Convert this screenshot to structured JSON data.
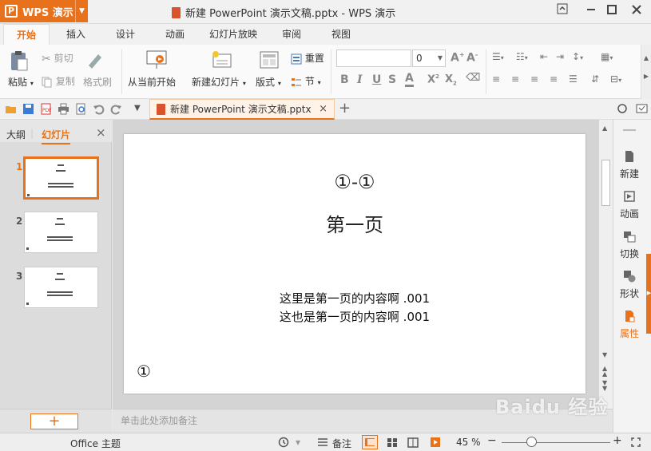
{
  "app": {
    "name": "WPS 演示",
    "logo": "P"
  },
  "window": {
    "title": "新建 PowerPoint 演示文稿.pptx - WPS 演示"
  },
  "tabs": [
    "开始",
    "插入",
    "设计",
    "动画",
    "幻灯片放映",
    "审阅",
    "视图"
  ],
  "ribbon": {
    "paste": "粘贴",
    "cut": "剪切",
    "copy": "复制",
    "format_painter": "格式刷",
    "from_current": "从当前开始",
    "new_slide": "新建幻灯片",
    "layout": "版式",
    "reset": "重置",
    "section": "节",
    "font_size": "0"
  },
  "document_tab": {
    "label": "新建 PowerPoint 演示文稿.pptx"
  },
  "left_pane": {
    "outline_tab": "大纲",
    "slides_tab": "幻灯片",
    "slide_numbers": [
      "1",
      "2",
      "3"
    ],
    "add_button": "+"
  },
  "slide": {
    "title": "①-①",
    "subtitle": "第一页",
    "body_lines": [
      "这里是第一页的内容啊 .001",
      "这也是第一页的内容啊 .001"
    ],
    "footer_number": "①"
  },
  "notes_placeholder": "单击此处添加备注",
  "right_panel": [
    "新建",
    "动画",
    "切换",
    "形状",
    "属性"
  ],
  "status": {
    "theme": "Office 主题",
    "notes": "备注",
    "zoom": "45 %",
    "zoom_level": 0.45
  },
  "colors": {
    "accent": "#e8721c"
  },
  "watermark": "Baidu 经验"
}
